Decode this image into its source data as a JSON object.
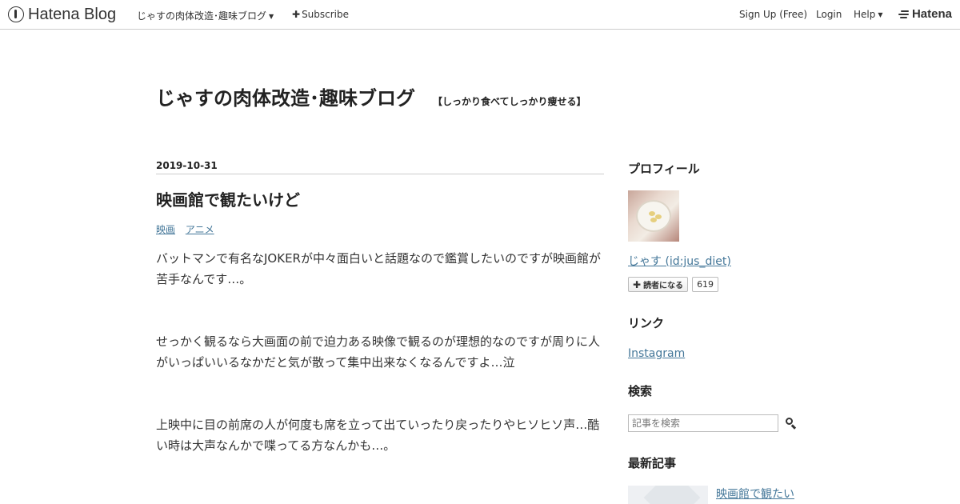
{
  "topbar": {
    "logo_text": "Hatena Blog",
    "blog_menu": "じゃすの肉体改造･趣味ブログ",
    "subscribe": "Subscribe",
    "signup": "Sign Up (Free)",
    "login": "Login",
    "help": "Help",
    "hatena": "Hatena"
  },
  "blog": {
    "title": "じゃすの肉体改造･趣味ブログ",
    "description": "【しっかり食べてしっかり痩せる】"
  },
  "entry": {
    "date": "2019-10-31",
    "title": "映画館で観たいけど",
    "categories": [
      "映画",
      "アニメ"
    ],
    "paragraphs": [
      "バットマンで有名なJOKERが中々面白いと話題なので鑑賞したいのですが映画館が苦手なんです…。",
      "せっかく観るなら大画面の前で迫力ある映像で観るのが理想的なのですが周りに人がいっぱいいるなかだと気が散って集中出来なくなるんですよ…泣",
      "上映中に目の前席の人が何度も席を立って出ていったり戻ったりやヒソヒソ声…酷い時は大声なんかで喋ってる方なんかも…。"
    ]
  },
  "sidebar": {
    "profile_heading": "プロフィール",
    "user_link": "じゃす (id:jus_diet)",
    "subscribe_label": "読者になる",
    "subscriber_count": "619",
    "links_heading": "リンク",
    "links": [
      "Instagram"
    ],
    "search_heading": "検索",
    "search_placeholder": "記事を検索",
    "recent_heading": "最新記事",
    "recent_entries": [
      "映画館で観たい"
    ]
  },
  "colors": {
    "link": "#447799",
    "text": "#333333"
  }
}
